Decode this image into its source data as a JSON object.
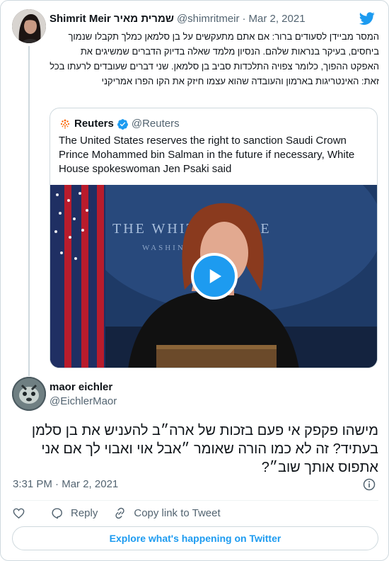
{
  "parent_tweet": {
    "author_name": "Shimrit Meir שמרית מאיר",
    "handle": "@shimritmeir",
    "separator": "·",
    "date": "Mar 2, 2021",
    "text": "המסר מביידן לסעודים ברור: אם אתם מתעקשים על בן סלמאן כמלך תקבלו שנמוך ביחסים, בעיקר בנראות שלהם. הנסיון מלמד שאלה בדיוק הדברים שמשיגים את האפקט ההפוך, כלומר צפויה התלכדות סביב בן סלמאן. שני דברים שעובדים לרעתו בכל זאת: האינטריגות בארמון והעובדה שהוא עצמו חיזק את הקו הפרו אמריקני"
  },
  "quoted_tweet": {
    "author_name": "Reuters",
    "handle": "@Reuters",
    "text": "The United States reserves the right to sanction Saudi Crown Prince Mohammed bin Salman in the future if necessary, White House spokeswoman Jen Psaki said",
    "video_backdrop_text": "THE WHITE HOUSE",
    "video_backdrop_subtext": "WASHINGTON"
  },
  "main_tweet": {
    "author_name": "maor eichler",
    "handle": "@EichlerMaor",
    "text": "מישהו פקפק אי פעם בזכות של ארה״ב להעניש את בן סלמן בעתיד? זה לא כמו הורה שאומר ״אבל אוי ואבוי לך אם אני אתפוס אותך שוב״?",
    "time": "3:31 PM",
    "separator": "·",
    "date": "Mar 2, 2021"
  },
  "actions": {
    "reply_label": "Reply",
    "copy_link_label": "Copy link to Tweet"
  },
  "explore_label": "Explore what's happening on Twitter",
  "colors": {
    "accent": "#1d9bf0",
    "muted_text": "#536471",
    "border": "#cfd9de",
    "primary_text": "#0f1419"
  },
  "icons": [
    "twitter-bird-icon",
    "reuters-logo-icon",
    "verified-badge-icon",
    "play-icon",
    "info-icon",
    "heart-icon",
    "reply-icon",
    "link-icon"
  ]
}
